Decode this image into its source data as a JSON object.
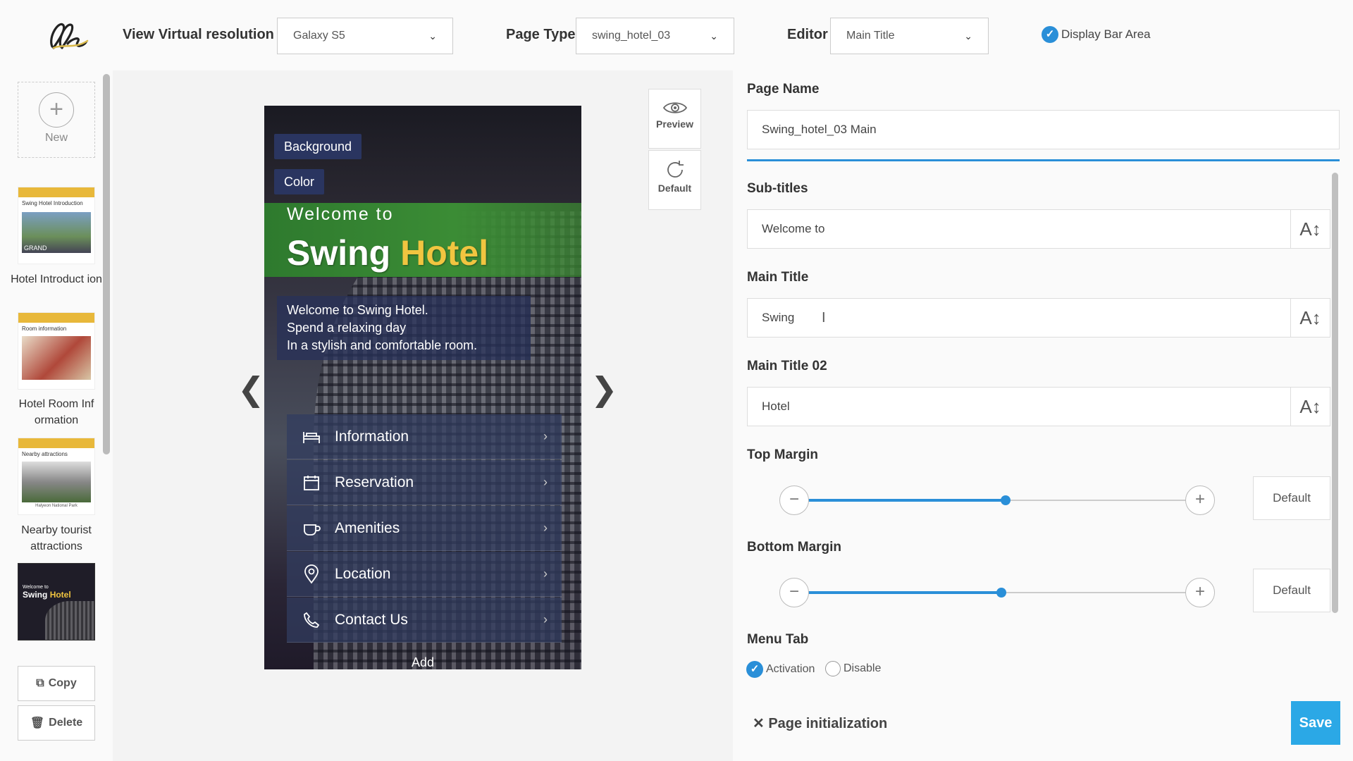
{
  "header": {
    "resolution_label": "View Virtual resolution",
    "resolution_value": "Galaxy S5",
    "page_type_label": "Page Type",
    "page_type_value": "swing_hotel_03",
    "editor_label": "Editor",
    "editor_value": "Main Title",
    "display_bar_label": "Display Bar Area",
    "display_bar_checked": true
  },
  "sidebar": {
    "new_label": "New",
    "thumbnails": [
      {
        "caption": "Hotel Introduct ion",
        "thumb_title": "Swing Hotel Introduction",
        "thumb_caption": "GRAND"
      },
      {
        "caption": "Hotel Room Inf ormation",
        "thumb_title": "Room information"
      },
      {
        "caption": "Nearby tourist attractions",
        "thumb_title": "Nearby attractions",
        "thumb_caption": "Halyeon National Park"
      },
      {
        "caption": "",
        "thumb_title": "Welcome to",
        "thumb_main": "Swing",
        "thumb_main2": "Hotel"
      }
    ],
    "copy_label": "Copy",
    "delete_label": "Delete"
  },
  "preview": {
    "tag_background": "Background",
    "tag_color": "Color",
    "subtitle": "Welcome to",
    "main_title": "Swing",
    "main_title_02": "Hotel",
    "description": [
      "Welcome to Swing Hotel.",
      "Spend a relaxing day",
      "In a stylish and comfortable room."
    ],
    "menu": [
      {
        "label": "Information",
        "icon": "bed-icon"
      },
      {
        "label": "Reservation",
        "icon": "calendar-icon"
      },
      {
        "label": "Amenities",
        "icon": "cup-icon"
      },
      {
        "label": "Location",
        "icon": "location-pin-icon"
      },
      {
        "label": "Contact Us",
        "icon": "phone-icon"
      }
    ],
    "add_label": "Add",
    "preview_btn": "Preview",
    "default_btn": "Default"
  },
  "form": {
    "page_name_label": "Page Name",
    "page_name_value": "Swing_hotel_03 Main",
    "subtitles_label": "Sub-titles",
    "subtitles_value": "Welcome to",
    "main_title_label": "Main Title",
    "main_title_value": "Swing",
    "main_title02_label": "Main Title 02",
    "main_title02_value": "Hotel",
    "top_margin_label": "Top Margin",
    "top_margin_level": 0.52,
    "bottom_margin_label": "Bottom Margin",
    "bottom_margin_level": 0.51,
    "default_label": "Default",
    "menu_tab_label": "Menu Tab",
    "activation_label": "Activation",
    "disable_label": "Disable",
    "menu_tab_selected": "Activation",
    "page_init_label": "Page initialization",
    "save_label": "Save"
  },
  "colors": {
    "accent": "#2a8fd8",
    "save": "#2ba8e6",
    "hotel_yellow": "#f1c540",
    "green_band": "#3b8c35"
  }
}
